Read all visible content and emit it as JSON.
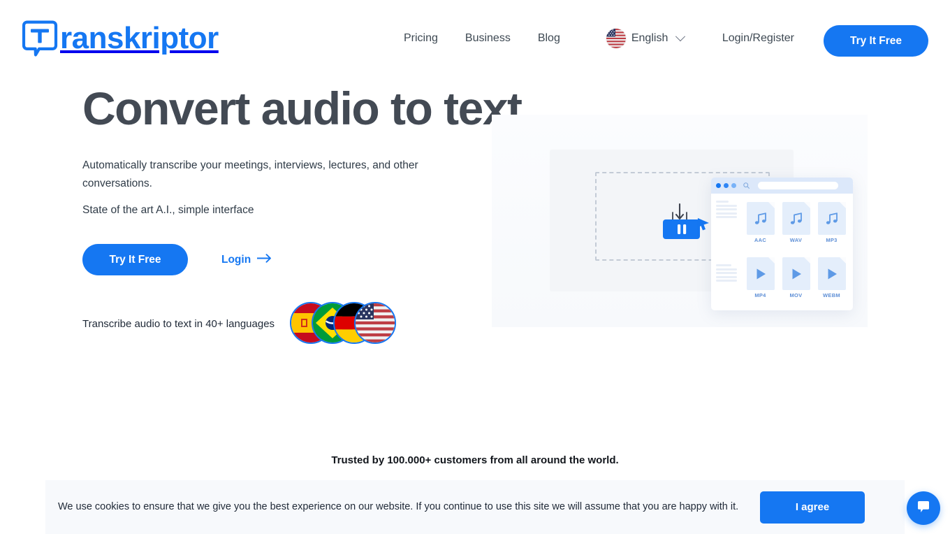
{
  "brand": {
    "logo_text": "ranskriptor",
    "logo_mark_letter": "T",
    "accent_color": "#1577f2",
    "heading_color": "#434a54"
  },
  "header": {
    "nav": [
      {
        "label": "Pricing",
        "name": "pricing"
      },
      {
        "label": "Business",
        "name": "business"
      },
      {
        "label": "Blog",
        "name": "blog"
      }
    ],
    "language": {
      "label": "English",
      "flag": "flag-us-icon",
      "chevron": "chevron-down-icon"
    },
    "login_register_label": "Login/Register",
    "try_free_label": "Try It Free"
  },
  "hero": {
    "title": "Convert audio to text",
    "subtitle": "Automatically transcribe your meetings, interviews, lectures, and other conversations.",
    "subtitle2": "State of the art A.I., simple interface",
    "cta_primary_label": "Try It Free",
    "cta_secondary_label": "Login",
    "cta_secondary_icon": "arrow-right-icon",
    "languages_text": "Transcribe audio to text in 40+ languages",
    "flags": [
      {
        "name": "flag-spain-icon",
        "country": "Spain"
      },
      {
        "name": "flag-brazil-icon",
        "country": "Brazil"
      },
      {
        "name": "flag-germany-icon",
        "country": "Germany"
      },
      {
        "name": "flag-usa-icon",
        "country": "United States"
      }
    ]
  },
  "illustration": {
    "upload_icon": "upload-pause-icon",
    "browser_dots": [
      "#1577f2",
      "#2f86f5",
      "#78b2f8"
    ],
    "file_formats": [
      {
        "label": "AAC",
        "icon": "music-note-icon"
      },
      {
        "label": "WAV",
        "icon": "music-note-icon"
      },
      {
        "label": "MP3",
        "icon": "music-note-icon"
      },
      {
        "label": "MP4",
        "icon": "play-triangle-icon"
      },
      {
        "label": "MOV",
        "icon": "play-triangle-icon"
      },
      {
        "label": "WEBM",
        "icon": "play-triangle-icon"
      }
    ]
  },
  "trusted": {
    "text": "Trusted by 100.000+ customers from all around the world."
  },
  "cookie": {
    "text": "We use cookies to ensure that we give you the best experience on our website. If you continue to use this site we will assume that you are happy with it.",
    "agree_label": "I agree"
  },
  "chat": {
    "icon": "chat-bubble-icon"
  }
}
